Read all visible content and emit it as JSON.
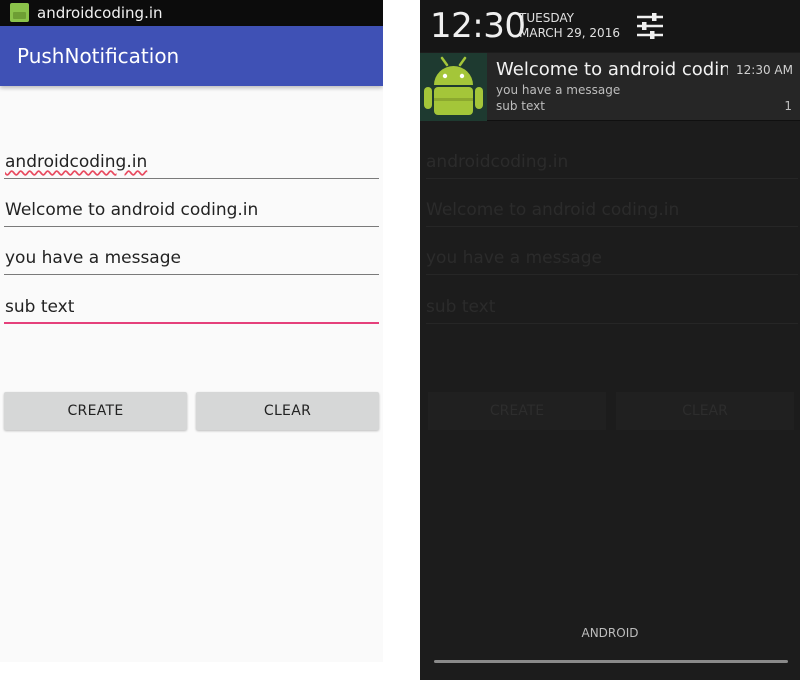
{
  "left": {
    "status_bar": {
      "title": "androidcoding.in",
      "icon": "android-app-icon"
    },
    "action_bar": {
      "title": "PushNotification"
    },
    "fields": [
      {
        "value": "androidcoding.in"
      },
      {
        "value": "Welcome to android coding.in"
      },
      {
        "value": "you have a message"
      },
      {
        "value": "sub text"
      }
    ],
    "buttons": {
      "create": "CREATE",
      "clear": "CLEAR"
    }
  },
  "right": {
    "header": {
      "time": "12:30",
      "day": "TUESDAY",
      "date": "MARCH 29, 2016",
      "settings_icon": "settings-sliders-icon"
    },
    "notification": {
      "icon": "android-robot-icon",
      "title": "Welcome to android coding",
      "time": "12:30 AM",
      "message": "you have a message",
      "subtext": "sub text",
      "count": "1"
    },
    "background_fields": [
      {
        "value": "androidcoding.in"
      },
      {
        "value": "Welcome to android coding.in"
      },
      {
        "value": "you have a message"
      },
      {
        "value": "sub text"
      }
    ],
    "background_buttons": {
      "create": "CREATE",
      "clear": "CLEAR"
    },
    "shade_label": "ANDROID"
  },
  "colors": {
    "primary": "#3f51b5",
    "accent": "#e5407b",
    "android_green": "#a4c639",
    "shade_background": "#1c1c1c"
  }
}
